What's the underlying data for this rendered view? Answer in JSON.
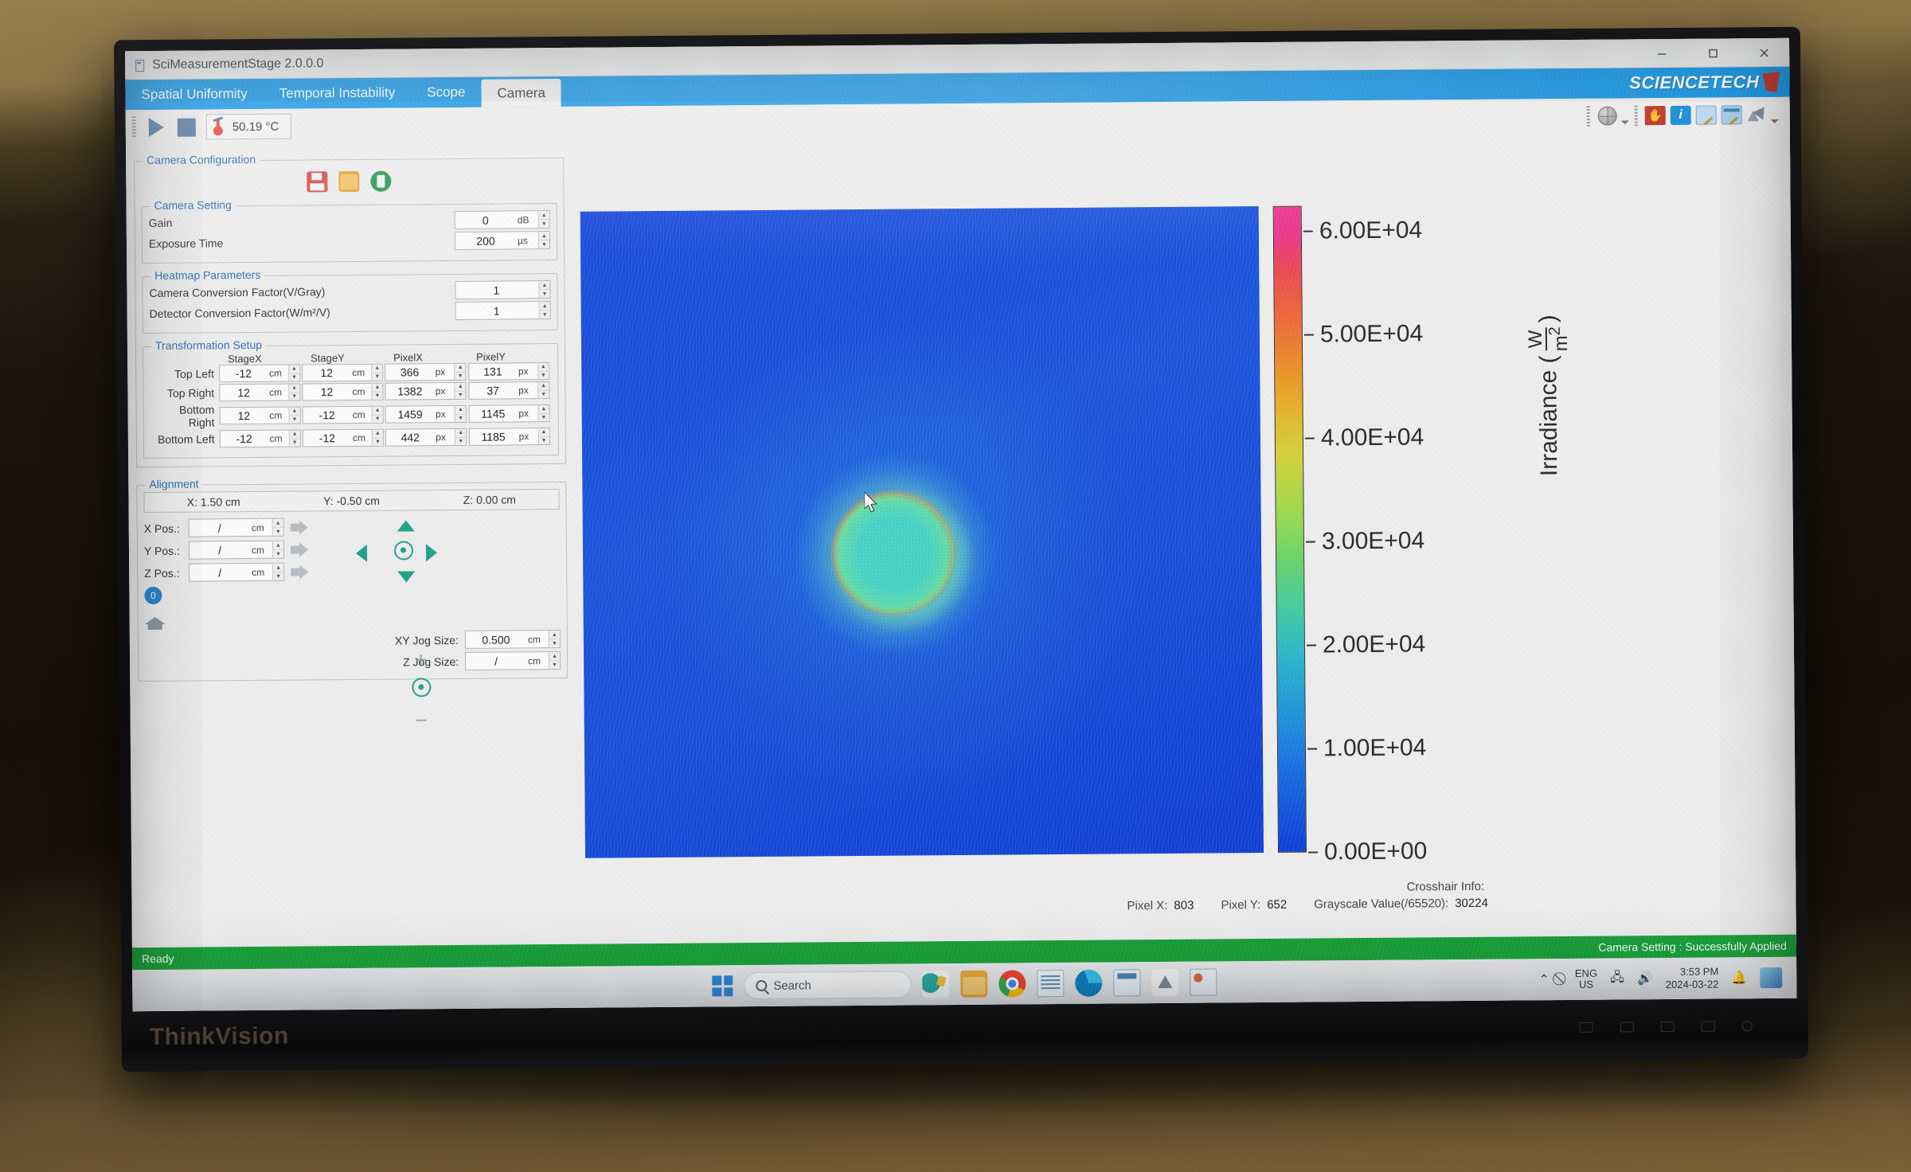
{
  "window": {
    "title": "SciMeasurementStage 2.0.0.0",
    "minimize": "–",
    "restore": "❐",
    "close": "✕"
  },
  "brand": {
    "name": "SCIENCETECH"
  },
  "tabs": [
    {
      "label": "Spatial Uniformity",
      "active": false
    },
    {
      "label": "Temporal Instability",
      "active": false
    },
    {
      "label": "Scope",
      "active": false
    },
    {
      "label": "Camera",
      "active": true
    }
  ],
  "toolbar": {
    "play": "play-button",
    "stop": "stop-button",
    "temperature": "50.19 °C"
  },
  "right_tools": [
    "globe-icon",
    "hand-icon",
    "info-icon",
    "edit-icon",
    "annotate-icon",
    "cursor-icon"
  ],
  "camera_configuration": {
    "group_label": "Camera Configuration",
    "actions": [
      "save-icon",
      "open-folder-icon",
      "apply-icon"
    ]
  },
  "camera_setting": {
    "group_label": "Camera Setting",
    "rows": [
      {
        "label": "Gain",
        "value": "0",
        "unit": "dB"
      },
      {
        "label": "Exposure Time",
        "value": "200",
        "unit": "µs"
      }
    ]
  },
  "heatmap_parameters": {
    "group_label": "Heatmap Parameters",
    "rows": [
      {
        "label": "Camera Conversion Factor(V/Gray)",
        "value": "1",
        "unit": ""
      },
      {
        "label": "Detector Conversion Factor(W/m²/V)",
        "value": "1",
        "unit": ""
      }
    ]
  },
  "transformation_setup": {
    "group_label": "Transformation Setup",
    "columns": [
      "StageX",
      "StageY",
      "PixelX",
      "PixelY"
    ],
    "rows": [
      {
        "label": "Top Left",
        "stagex": "-12",
        "stagey": "12",
        "pixelx": "366",
        "pixely": "131"
      },
      {
        "label": "Top Right",
        "stagex": "12",
        "stagey": "12",
        "pixelx": "1382",
        "pixely": "37"
      },
      {
        "label": "Bottom Right",
        "stagex": "12",
        "stagey": "-12",
        "pixelx": "1459",
        "pixely": "1145"
      },
      {
        "label": "Bottom Left",
        "stagex": "-12",
        "stagey": "-12",
        "pixelx": "442",
        "pixely": "1185"
      }
    ],
    "units": {
      "stage": "cm",
      "pixel": "px"
    }
  },
  "alignment": {
    "group_label": "Alignment",
    "readout": {
      "x": "X: 1.50 cm",
      "y": "Y: -0.50 cm",
      "z": "Z: 0.00 cm"
    },
    "positions": [
      {
        "label": "X Pos.:",
        "value": "/",
        "unit": "cm"
      },
      {
        "label": "Y Pos.:",
        "value": "/",
        "unit": "cm"
      },
      {
        "label": "Z Pos.:",
        "value": "/",
        "unit": "cm"
      }
    ],
    "zero_button": "0",
    "home_button": "home-icon",
    "jog": [
      {
        "label": "XY Jog Size:",
        "value": "0.500",
        "unit": "cm"
      },
      {
        "label": "Z Jog Size:",
        "value": "/",
        "unit": "cm"
      }
    ]
  },
  "colorbar": {
    "label_prefix": "Irradiance (",
    "label_num": "W",
    "label_den": "m",
    "label_den_sup": "2",
    "label_suffix": ")",
    "ticks": [
      "6.00E+04",
      "5.00E+04",
      "4.00E+04",
      "3.00E+04",
      "2.00E+04",
      "1.00E+04",
      "0.00E+00"
    ]
  },
  "chart_data": {
    "type": "heatmap",
    "title": "",
    "colorbar_label": "Irradiance (W/m^2)",
    "colorbar_ticks": [
      60000,
      50000,
      40000,
      30000,
      20000,
      10000,
      0
    ],
    "zlim": [
      0,
      60000
    ],
    "colormap": "jet",
    "description": "Camera irradiance heatmap showing a bright annular ring hotspot near center, peak on the right side of the ring; background uniformly low (deep blue).",
    "features": [
      {
        "name": "background",
        "approx_value": 8000,
        "color": "#1548e0"
      },
      {
        "name": "ring_mid",
        "approx_value": 32000,
        "color": "#7de07e"
      },
      {
        "name": "ring_peak",
        "approx_value": 52000,
        "color": "#f0463c"
      },
      {
        "name": "ring_interior",
        "approx_value": 28000,
        "color": "#46d6c8"
      }
    ]
  },
  "crosshair": {
    "title": "Crosshair Info:",
    "pixel_x_label": "Pixel X:",
    "pixel_x": "803",
    "pixel_y_label": "Pixel Y:",
    "pixel_y": "652",
    "grayscale_label": "Grayscale Value(/65520):",
    "grayscale": "30224"
  },
  "status": {
    "left": "Ready",
    "right": "Camera Setting : Successfully Applied"
  },
  "taskbar": {
    "search_placeholder": "Search",
    "apps": [
      "paint-icon",
      "folder-icon",
      "chrome-icon",
      "notepad-icon",
      "edge-icon",
      "calculator-icon",
      "matlab-icon",
      "contacts-icon"
    ],
    "tray": {
      "chevron": "⌃",
      "language_line1": "ENG",
      "language_line2": "US",
      "time": "3:53 PM",
      "date": "2024-03-22"
    }
  },
  "monitor": {
    "brand": "ThinkVision"
  },
  "colors": {
    "accent_blue": "#1b9ae8",
    "status_green": "#18a23a",
    "brand_red": "#c0392b"
  }
}
